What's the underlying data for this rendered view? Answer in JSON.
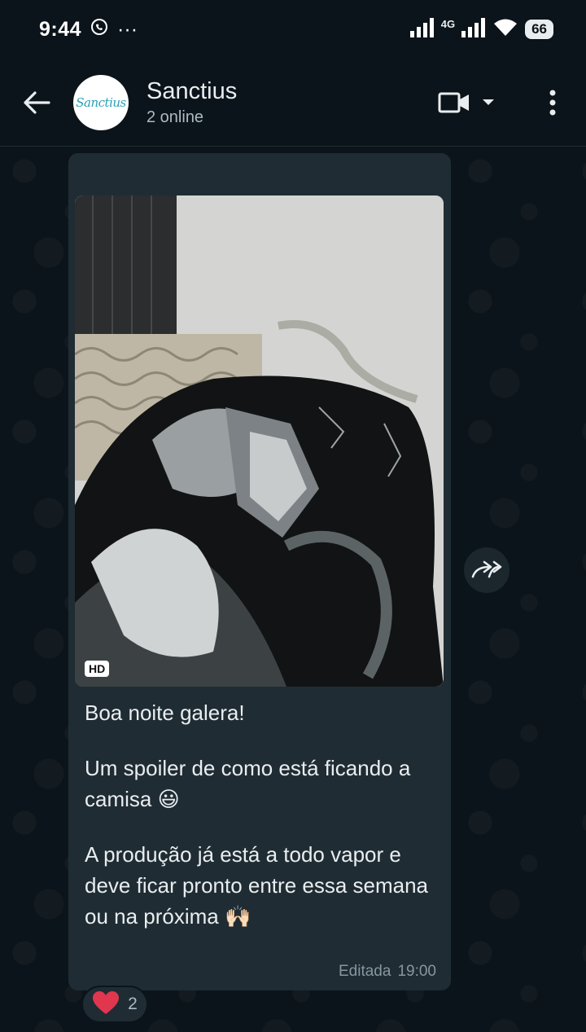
{
  "status_bar": {
    "time": "9:44",
    "more": "···",
    "network": "4G",
    "battery": "66"
  },
  "header": {
    "title": "Sanctius",
    "subtitle": "2 online",
    "avatar_text": "Sanctius"
  },
  "message": {
    "line1": "Boa noite galera!",
    "line2": "Um spoiler de como está ficando a camisa 😃",
    "line3": "A produção já está a todo vapor e deve ficar pronto entre essa semana ou na próxima 🙌🏻",
    "edited_label": "Editada",
    "time": "19:00",
    "hd_badge": "HD"
  },
  "reaction": {
    "emoji": "❤️",
    "count": "2"
  },
  "colors": {
    "background": "#0b141a",
    "bubble": "#1f2c33",
    "text_primary": "#e9edef",
    "text_secondary": "#8696a0"
  }
}
